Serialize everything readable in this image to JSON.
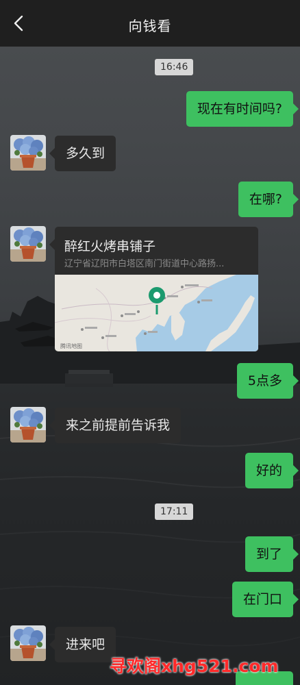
{
  "header": {
    "title": "向钱看"
  },
  "timestamps": [
    "16:46",
    "17:11"
  ],
  "messages": [
    {
      "side": "right",
      "text": "现在有时间吗?"
    },
    {
      "side": "left",
      "text": "多久到"
    },
    {
      "side": "right",
      "text": "在哪?"
    },
    {
      "side": "left",
      "type": "location",
      "name": "醉红火烤串铺子",
      "address": "辽宁省辽阳市白塔区南门街道中心路扬..."
    },
    {
      "side": "right",
      "text": "5点多"
    },
    {
      "side": "left",
      "text": "来之前提前告诉我"
    },
    {
      "side": "right",
      "text": "好的"
    },
    {
      "side": "right",
      "text": "到了"
    },
    {
      "side": "right",
      "text": "在门口"
    },
    {
      "side": "left",
      "text": "进来吧"
    }
  ],
  "map": {
    "attribution": "腾讯地图",
    "pin_color": "#1b9a6e"
  },
  "watermark": "寻欢阁xhg521.com",
  "colors": {
    "header_bg": "#1f1f1f",
    "bubble_right": "#3ec060",
    "bubble_left": "#2c2c2c",
    "timestamp_bg": "#d7d7d7"
  }
}
